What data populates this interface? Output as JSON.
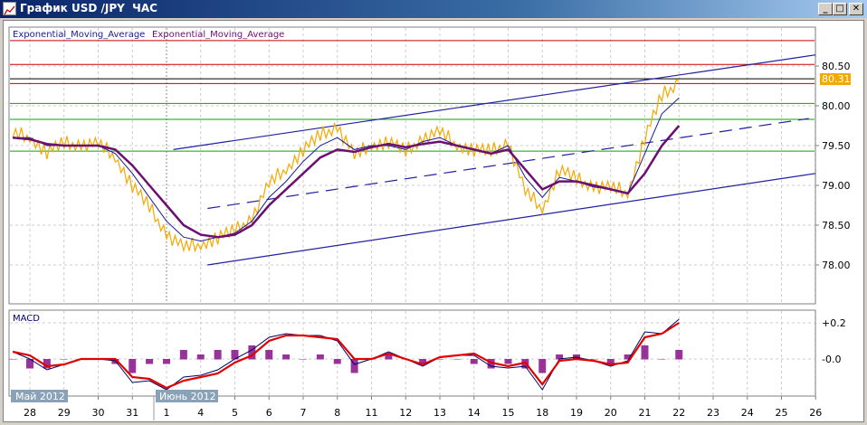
{
  "window": {
    "title": "График USD /JPY  ЧАС",
    "minimize": "_",
    "maximize": "□",
    "close": "✕"
  },
  "legend": {
    "ema1": "Exponential_Moving_Average",
    "ema2": "Exponential_Moving_Average"
  },
  "price_axis": {
    "ticks": [
      "80.50",
      "80.00",
      "79.50",
      "79.00",
      "78.50",
      "78.00"
    ],
    "current": "80.31"
  },
  "macd": {
    "title": "MACD",
    "ticks": [
      "+0.2",
      "-0.0"
    ]
  },
  "month_tags": [
    "Май 2012",
    "Июнь 2012"
  ],
  "colors": {
    "price": "#f5a800",
    "ema_fast": "#1a1a9a",
    "ema_slow": "#6b1070",
    "macd": "#000066",
    "signal": "#e00000",
    "hist": "#800080",
    "channel": "#2020a0"
  },
  "chart_data": {
    "type": "line",
    "title": "USD/JPY hourly",
    "x_ticks": [
      "28",
      "29",
      "30",
      "31",
      "1",
      "4",
      "5",
      "6",
      "7",
      "8",
      "11",
      "12",
      "13",
      "14",
      "15",
      "18",
      "19",
      "20",
      "21",
      "22",
      "23",
      "24",
      "25",
      "26"
    ],
    "x_start": -0.5,
    "x_step": 0.5,
    "ylim": [
      77.8,
      80.95
    ],
    "horizontal_levels": [
      {
        "value": 80.82,
        "color": "#cc0000"
      },
      {
        "value": 80.52,
        "color": "#cc0000"
      },
      {
        "value": 80.28,
        "color": "#cc0000"
      },
      {
        "value": 80.34,
        "color": "#000000"
      },
      {
        "value": 80.03,
        "color": "#00aa00"
      },
      {
        "value": 79.83,
        "color": "#00aa00"
      },
      {
        "value": 79.43,
        "color": "#00aa00"
      }
    ],
    "channel": [
      {
        "x0": 4.2,
        "y0": 79.45,
        "x1": 23.0,
        "y1": 80.64,
        "dashed": false
      },
      {
        "x0": 5.2,
        "y0": 78.71,
        "x1": 22.8,
        "y1": 79.84,
        "dashed": true
      },
      {
        "x0": 5.2,
        "y0": 78.0,
        "x1": 23.0,
        "y1": 79.15,
        "dashed": false
      }
    ],
    "series": [
      {
        "name": "Price",
        "values": [
          79.62,
          79.6,
          79.42,
          79.5,
          79.52,
          79.5,
          79.35,
          79.0,
          78.7,
          78.4,
          78.2,
          78.25,
          78.35,
          78.4,
          78.6,
          79.0,
          79.2,
          79.45,
          79.6,
          79.75,
          79.35,
          79.5,
          79.55,
          79.4,
          79.6,
          79.65,
          79.5,
          79.45,
          79.4,
          79.55,
          78.9,
          78.7,
          79.2,
          79.05,
          79.0,
          78.95,
          78.9,
          79.6,
          80.1,
          80.31
        ]
      },
      {
        "name": "Exponential_Moving_Average",
        "values": [
          79.6,
          79.6,
          79.5,
          79.5,
          79.5,
          79.5,
          79.4,
          79.15,
          78.85,
          78.55,
          78.35,
          78.3,
          78.35,
          78.4,
          78.55,
          78.85,
          79.05,
          79.3,
          79.5,
          79.6,
          79.45,
          79.5,
          79.5,
          79.45,
          79.55,
          79.6,
          79.5,
          79.45,
          79.4,
          79.5,
          79.1,
          78.85,
          79.1,
          79.05,
          78.98,
          78.95,
          78.9,
          79.4,
          79.9,
          80.1
        ]
      },
      {
        "name": "Exponential_Moving_Average",
        "values": [
          79.6,
          79.58,
          79.52,
          79.5,
          79.5,
          79.5,
          79.45,
          79.25,
          79.0,
          78.75,
          78.5,
          78.38,
          78.35,
          78.38,
          78.5,
          78.75,
          78.95,
          79.15,
          79.35,
          79.45,
          79.42,
          79.48,
          79.52,
          79.48,
          79.52,
          79.55,
          79.5,
          79.45,
          79.4,
          79.45,
          79.2,
          78.95,
          79.05,
          79.05,
          79.0,
          78.95,
          78.9,
          79.15,
          79.5,
          79.75
        ]
      }
    ],
    "macd_series": [
      {
        "name": "MACD",
        "values": [
          0.04,
          0.0,
          -0.06,
          -0.03,
          0.0,
          0.0,
          -0.01,
          -0.13,
          -0.12,
          -0.17,
          -0.1,
          -0.09,
          -0.06,
          0.0,
          0.05,
          0.12,
          0.14,
          0.13,
          0.13,
          0.1,
          -0.03,
          0.0,
          0.04,
          0.0,
          -0.04,
          0.01,
          0.02,
          0.02,
          -0.04,
          -0.05,
          -0.04,
          -0.17,
          0.0,
          0.01,
          -0.01,
          -0.04,
          -0.01,
          0.15,
          0.14,
          0.22
        ]
      },
      {
        "name": "Signal",
        "values": [
          0.04,
          0.02,
          -0.04,
          -0.03,
          0.0,
          0.0,
          0.0,
          -0.1,
          -0.11,
          -0.16,
          -0.12,
          -0.1,
          -0.08,
          -0.02,
          0.02,
          0.1,
          0.13,
          0.13,
          0.12,
          0.11,
          0.0,
          0.0,
          0.03,
          0.0,
          -0.03,
          0.01,
          0.02,
          0.03,
          -0.02,
          -0.04,
          -0.02,
          -0.14,
          -0.01,
          0.0,
          -0.01,
          -0.03,
          -0.02,
          0.12,
          0.14,
          0.2
        ]
      }
    ],
    "macd_ylim": [
      -0.2,
      0.25
    ]
  }
}
